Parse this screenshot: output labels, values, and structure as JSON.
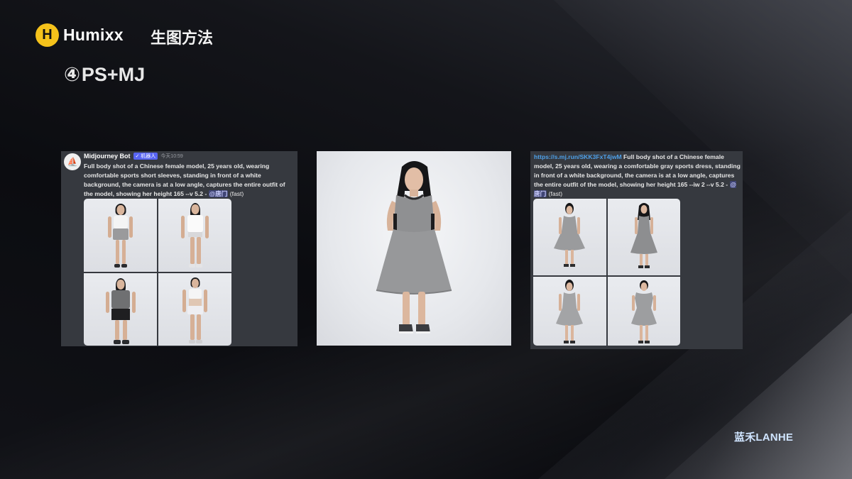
{
  "header": {
    "logo_mark": "H",
    "logo_text": "Humixx",
    "section_title": "生图方法",
    "step_number": "④",
    "step_title": "PS+MJ"
  },
  "left_message": {
    "bot_name": "Midjourney Bot",
    "badge": "✓ 机器人",
    "time": "今天10:59",
    "prompt": "Full body shot of a Chinese female model, 25 years old, wearing comfortable sports short sleeves, standing in front of a white background, the camera is at a low angle, captures the entire outfit of the model, showing her height 165 --v 5.2 -",
    "mention": "@唐门",
    "mode": "(fast)"
  },
  "right_message": {
    "link": "https://s.mj.run/SKK3FxT4jwM",
    "prompt": " Full body shot of a Chinese female model, 25 years old, wearing a comfortable gray sports dress, standing in front of a white background, the camera is at a low angle, captures the entire outfit of the model, showing her height 165 --iw 2 --v 5.2 -",
    "mention": "@唐门",
    "mode": "(fast)"
  },
  "footer": {
    "brand": "蓝禾LANHE"
  },
  "colors": {
    "accent_yellow": "#f5c21b",
    "discord_bg": "#36393f",
    "link_blue": "#4ea0e8",
    "brand_blue": "#cfe4ff"
  }
}
